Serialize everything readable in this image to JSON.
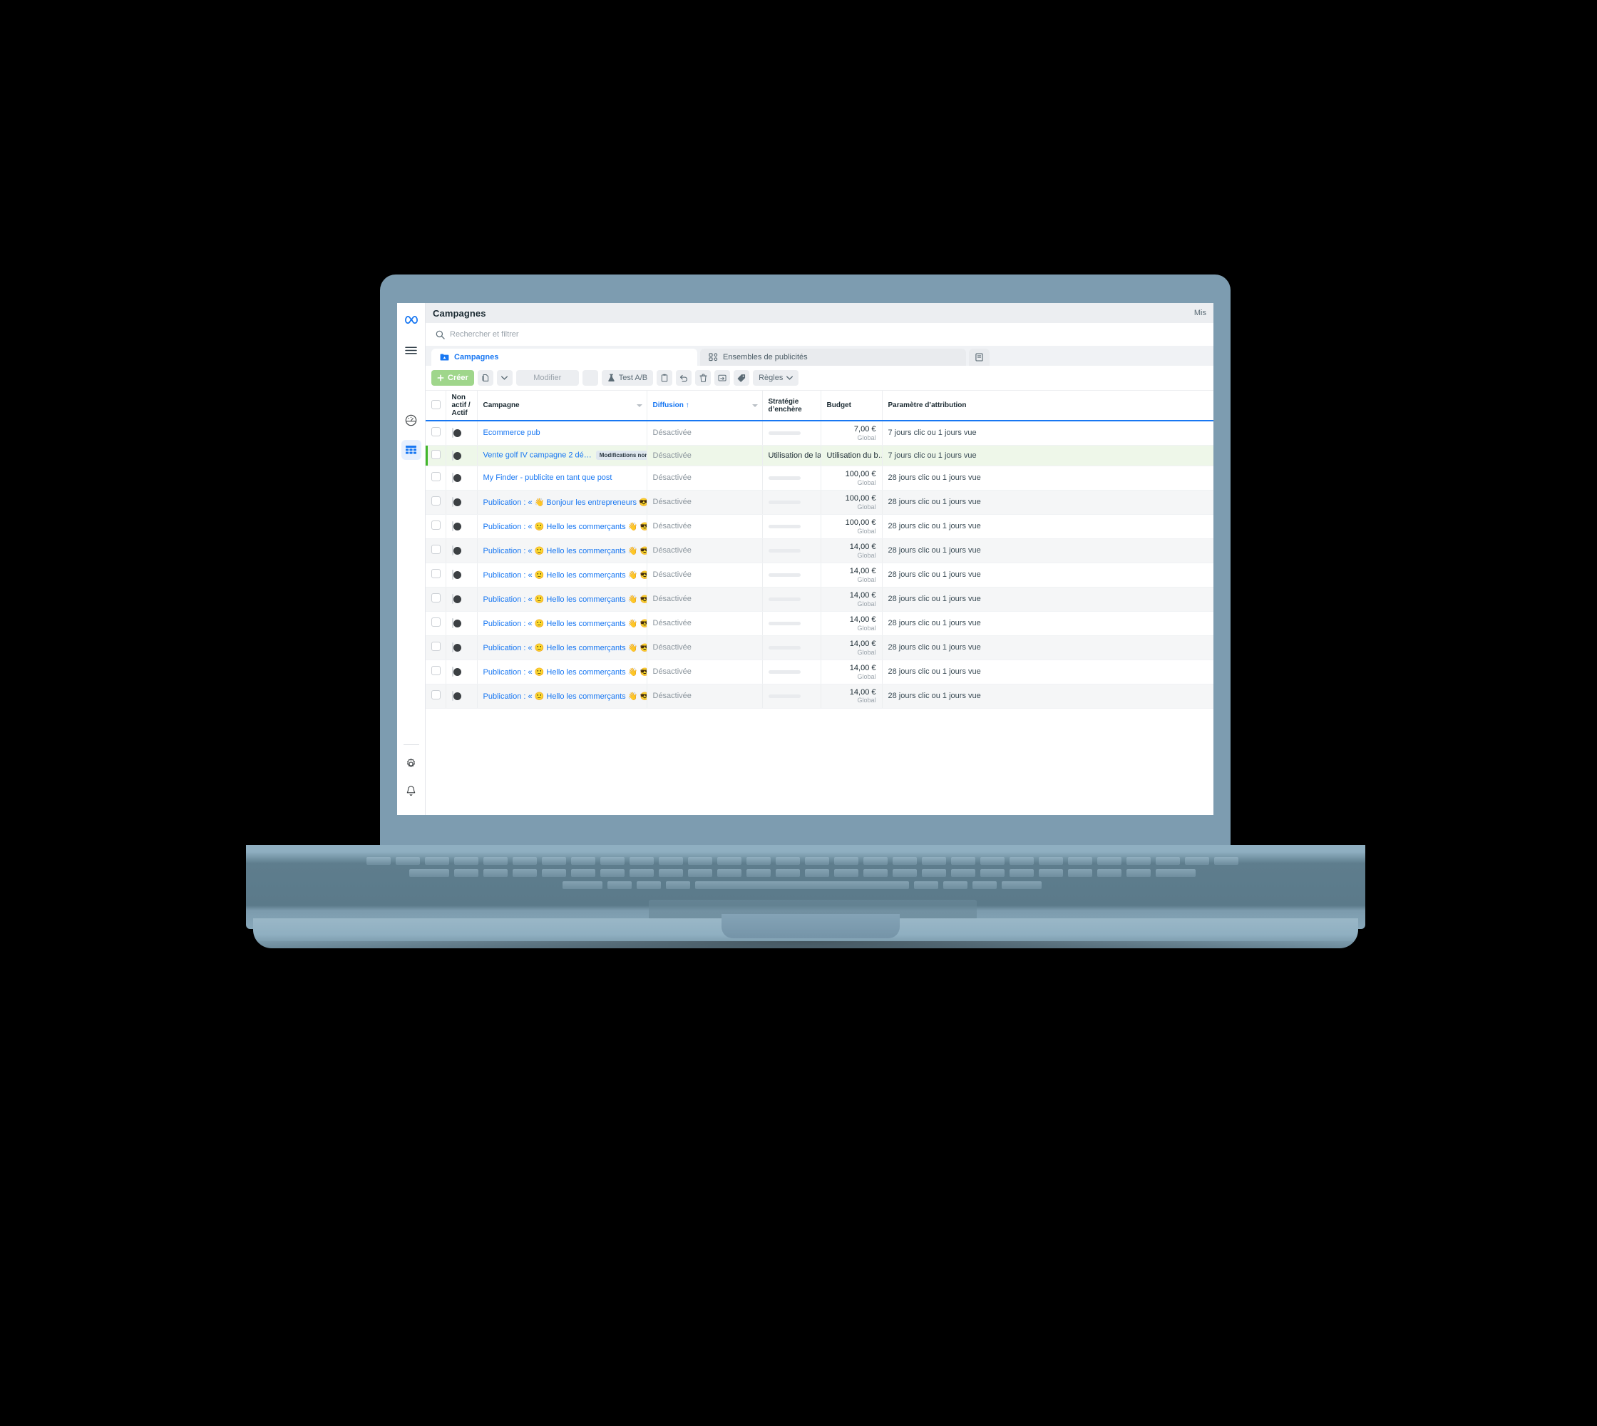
{
  "app": {
    "brand_icon": "meta-logo-icon",
    "accent_blue": "#1877f2",
    "accent_green": "#42b72a",
    "frame_color": "#7d9cb0"
  },
  "left_rail": {
    "items": [
      {
        "name": "meta-logo-icon",
        "label": "Meta"
      },
      {
        "name": "hamburger-menu-icon",
        "label": "Menu"
      },
      {
        "name": "performance-gauge-icon",
        "label": "Performance"
      },
      {
        "name": "table-grid-icon",
        "label": "Tableau",
        "active": true
      }
    ],
    "bottom_items": [
      {
        "name": "gear-icon",
        "label": "Paramètres"
      },
      {
        "name": "bell-icon",
        "label": "Notifications"
      }
    ]
  },
  "header": {
    "title": "Campagnes",
    "right_text": "Mis"
  },
  "search": {
    "icon": "search-icon",
    "placeholder": "Rechercher et filtrer"
  },
  "tabs": [
    {
      "label": "Campagnes",
      "icon": "campaign-folder-icon",
      "active": true
    },
    {
      "label": "Ensembles de publicités",
      "icon": "adset-icon",
      "active": false
    },
    {
      "label": "",
      "icon": "ads-icon",
      "active": false
    }
  ],
  "toolbar": {
    "create_label": "Créer",
    "create_icon": "plus-icon",
    "duplicate_icon": "duplicate-icon",
    "dropdown_icon": "chevron-down-icon",
    "edit_label": "Modifier",
    "edit_more_icon": "edit-more-icon",
    "ab_test_label": "Test A/B",
    "ab_test_icon": "flask-icon",
    "copy_icon": "clipboard-icon",
    "undo_icon": "undo-icon",
    "delete_icon": "trash-icon",
    "export_icon": "export-icon",
    "tag_icon": "tag-icon",
    "rules_label": "Règles",
    "rules_caret_icon": "chevron-down-icon"
  },
  "table": {
    "columns": [
      {
        "key": "check",
        "label": ""
      },
      {
        "key": "toggle",
        "label": "Non actif / Actif"
      },
      {
        "key": "name",
        "label": "Campagne",
        "has_caret": true
      },
      {
        "key": "deliv",
        "label": "Diffusion ↑",
        "sorted": true,
        "has_caret": true
      },
      {
        "key": "strat",
        "label": "Stratégie d’enchère"
      },
      {
        "key": "budget",
        "label": "Budget"
      },
      {
        "key": "attr",
        "label": "Paramètre d’attribution"
      }
    ],
    "rows": [
      {
        "name": "Ecommerce pub",
        "badge": "",
        "delivery": "Désactivée",
        "strategy": "",
        "strategy_skeleton": true,
        "budget": "7,00 €",
        "budget_sub": "Global",
        "budget_skeleton": false,
        "attribution": "7 jours clic ou 1 jours vue",
        "highlight": false
      },
      {
        "name": "Vente golf IV campagne 2 dé…",
        "badge": "Modifications non publiées",
        "delivery": "Désactivée",
        "strategy": "Utilisation de la …",
        "strategy_skeleton": false,
        "budget": "Utilisation du b…",
        "budget_sub": "",
        "budget_skeleton": false,
        "attribution": "7 jours clic ou 1 jours vue",
        "highlight": true
      },
      {
        "name": "My Finder - publicite en tant que post",
        "badge": "",
        "delivery": "Désactivée",
        "strategy": "",
        "strategy_skeleton": true,
        "budget": "100,00 €",
        "budget_sub": "Global",
        "budget_skeleton": false,
        "attribution": "28 jours clic ou 1 jours vue",
        "highlight": false
      },
      {
        "name": "Publication : « 👋 Bonjour les entrepreneurs 😎 »",
        "badge": "",
        "delivery": "Désactivée",
        "strategy": "",
        "strategy_skeleton": true,
        "budget": "100,00 €",
        "budget_sub": "Global",
        "budget_skeleton": false,
        "attribution": "28 jours clic ou 1 jours vue",
        "highlight": false
      },
      {
        "name": "Publication : « 🙂 Hello les commerçants 👋 😎 »",
        "badge": "",
        "delivery": "Désactivée",
        "strategy": "",
        "strategy_skeleton": true,
        "budget": "100,00 €",
        "budget_sub": "Global",
        "budget_skeleton": false,
        "attribution": "28 jours clic ou 1 jours vue",
        "highlight": false
      },
      {
        "name": "Publication : « 🙂 Hello les commerçants 👋 😎 »",
        "badge": "",
        "delivery": "Désactivée",
        "strategy": "",
        "strategy_skeleton": true,
        "budget": "14,00 €",
        "budget_sub": "Global",
        "budget_skeleton": false,
        "attribution": "28 jours clic ou 1 jours vue",
        "highlight": false
      },
      {
        "name": "Publication : « 🙂 Hello les commerçants 👋 😎 »",
        "badge": "",
        "delivery": "Désactivée",
        "strategy": "",
        "strategy_skeleton": true,
        "budget": "14,00 €",
        "budget_sub": "Global",
        "budget_skeleton": false,
        "attribution": "28 jours clic ou 1 jours vue",
        "highlight": false
      },
      {
        "name": "Publication : « 🙂 Hello les commerçants 👋 😎 »",
        "badge": "",
        "delivery": "Désactivée",
        "strategy": "",
        "strategy_skeleton": true,
        "budget": "14,00 €",
        "budget_sub": "Global",
        "budget_skeleton": false,
        "attribution": "28 jours clic ou 1 jours vue",
        "highlight": false
      },
      {
        "name": "Publication : « 🙂 Hello les commerçants 👋 😎 »",
        "badge": "",
        "delivery": "Désactivée",
        "strategy": "",
        "strategy_skeleton": true,
        "budget": "14,00 €",
        "budget_sub": "Global",
        "budget_skeleton": false,
        "attribution": "28 jours clic ou 1 jours vue",
        "highlight": false
      },
      {
        "name": "Publication : « 🙂 Hello les commerçants 👋 😎 »",
        "badge": "",
        "delivery": "Désactivée",
        "strategy": "",
        "strategy_skeleton": true,
        "budget": "14,00 €",
        "budget_sub": "Global",
        "budget_skeleton": false,
        "attribution": "28 jours clic ou 1 jours vue",
        "highlight": false
      },
      {
        "name": "Publication : « 🙂 Hello les commerçants 👋 😎 »",
        "badge": "",
        "delivery": "Désactivée",
        "strategy": "",
        "strategy_skeleton": true,
        "budget": "14,00 €",
        "budget_sub": "Global",
        "budget_skeleton": false,
        "attribution": "28 jours clic ou 1 jours vue",
        "highlight": false
      },
      {
        "name": "Publication : « 🙂 Hello les commerçants 👋 😎 »",
        "badge": "",
        "delivery": "Désactivée",
        "strategy": "",
        "strategy_skeleton": true,
        "budget": "14,00 €",
        "budget_sub": "Global",
        "budget_skeleton": false,
        "attribution": "28 jours clic ou 1 jours vue",
        "highlight": false
      }
    ]
  }
}
